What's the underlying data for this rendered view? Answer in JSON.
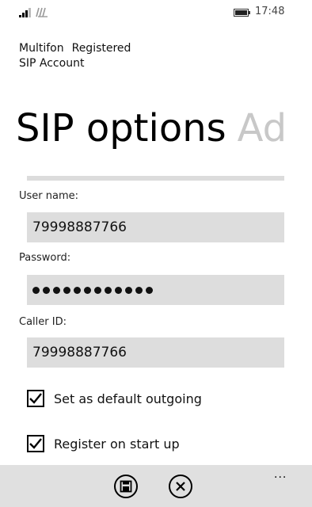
{
  "status": {
    "time": "17:48",
    "icons": [
      "signal-icon",
      "wifi-icon",
      "battery-icon"
    ]
  },
  "account": {
    "name": "Multifon",
    "state": "Registered",
    "type": "SIP Account"
  },
  "pivot": {
    "active": "SIP options",
    "next": "Ad"
  },
  "form": {
    "user_name_label": "User name:",
    "user_name_value": "79998887766",
    "password_label": "Password:",
    "password_length": 12,
    "caller_id_label": "Caller ID:",
    "caller_id_value": "79998887766"
  },
  "options": [
    {
      "label": "Set as default outgoing",
      "checked": true
    },
    {
      "label": "Register on start up",
      "checked": true
    }
  ],
  "app_bar": {
    "buttons": [
      "save-icon",
      "cancel-icon"
    ],
    "more": "..."
  },
  "colors": {
    "field_bg": "#dddddd",
    "app_bar_bg": "#e0e0e0",
    "inactive_pivot": "#c8c8c8"
  }
}
